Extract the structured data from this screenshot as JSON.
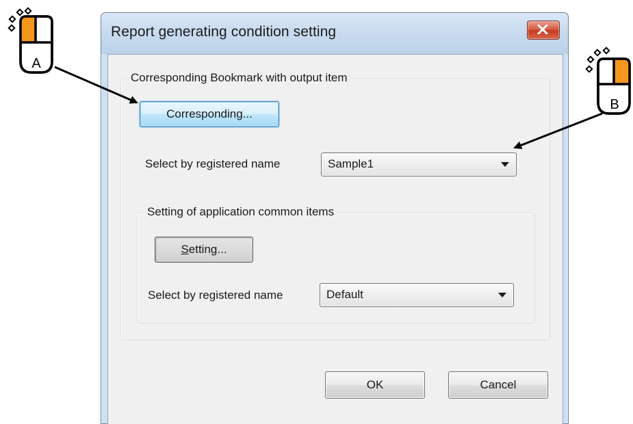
{
  "dialog": {
    "title": "Report generating condition setting"
  },
  "bookmark_group": {
    "legend": "Corresponding Bookmark with output item",
    "corresponding_button": "Corresponding...",
    "select_label": "Select by registered name",
    "select_value": "Sample1"
  },
  "common_group": {
    "legend": "Setting of application common items",
    "setting_button_mnemonic": "S",
    "setting_button_rest": "etting...",
    "select_label": "Select by registered name",
    "select_value": "Default"
  },
  "footer": {
    "ok_label": "OK",
    "cancel_label": "Cancel"
  },
  "callouts": {
    "a_label": "A",
    "b_label": "B"
  },
  "colors": {
    "mouse_highlight": "#f5961e",
    "arrow": "#000000",
    "focus_blue": "#3c7fb1",
    "close_red": "#d6543b"
  },
  "icons": [
    "close-icon",
    "dropdown-arrow-icon",
    "mouse-left-click-icon",
    "mouse-right-click-icon"
  ]
}
